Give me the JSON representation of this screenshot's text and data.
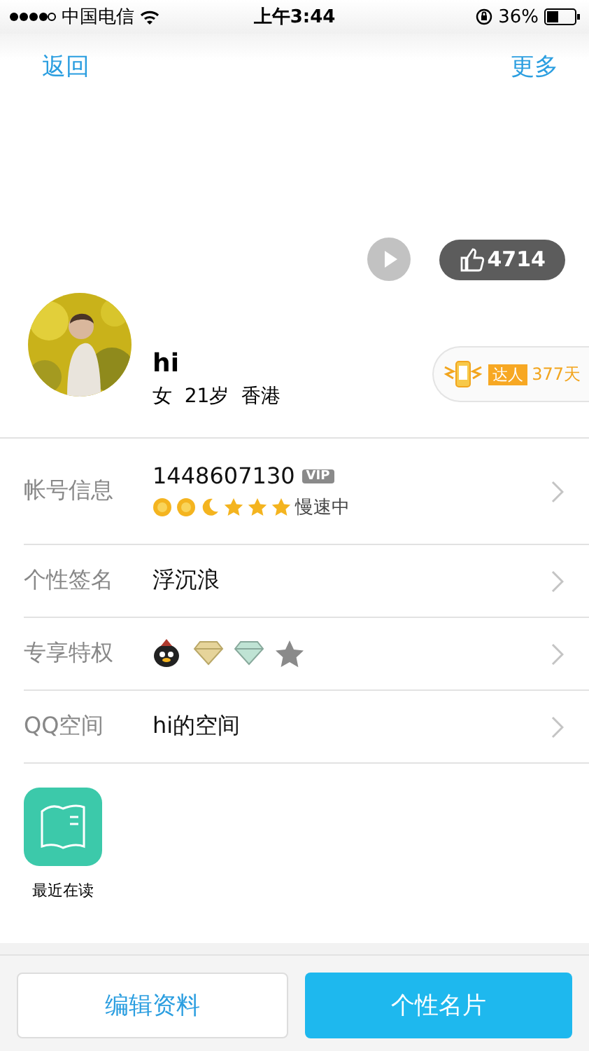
{
  "status_bar": {
    "carrier": "中国电信",
    "time": "上午3:44",
    "battery": "36%"
  },
  "nav": {
    "back": "返回",
    "more": "更多"
  },
  "header": {
    "likes": "4714",
    "name": "hi",
    "details": "女  21岁  香港",
    "badge": {
      "label": "达人",
      "days": "377天"
    }
  },
  "rows": [
    {
      "label": "帐号信息",
      "value": "1448607130",
      "vip": "VIP",
      "level_icons": [
        {
          "kind": "sun"
        },
        {
          "kind": "sun"
        },
        {
          "kind": "moon"
        },
        {
          "kind": "star"
        },
        {
          "kind": "star"
        },
        {
          "kind": "star"
        }
      ],
      "level_note": "慢速中"
    },
    {
      "label": "个性签名",
      "value": "浮沉浪"
    },
    {
      "label": "专享特权",
      "privileges": [
        {
          "kind": "penguin"
        },
        {
          "kind": "gold-diamond"
        },
        {
          "kind": "green-diamond"
        },
        {
          "kind": "grey-star"
        }
      ]
    },
    {
      "label": "QQ空间",
      "value": "hi的空间"
    }
  ],
  "apps": [
    {
      "label": "最近在读"
    }
  ],
  "buttons": [
    {
      "label": "编辑资料",
      "kind": "secondary"
    },
    {
      "label": "个性名片",
      "kind": "primary"
    }
  ]
}
